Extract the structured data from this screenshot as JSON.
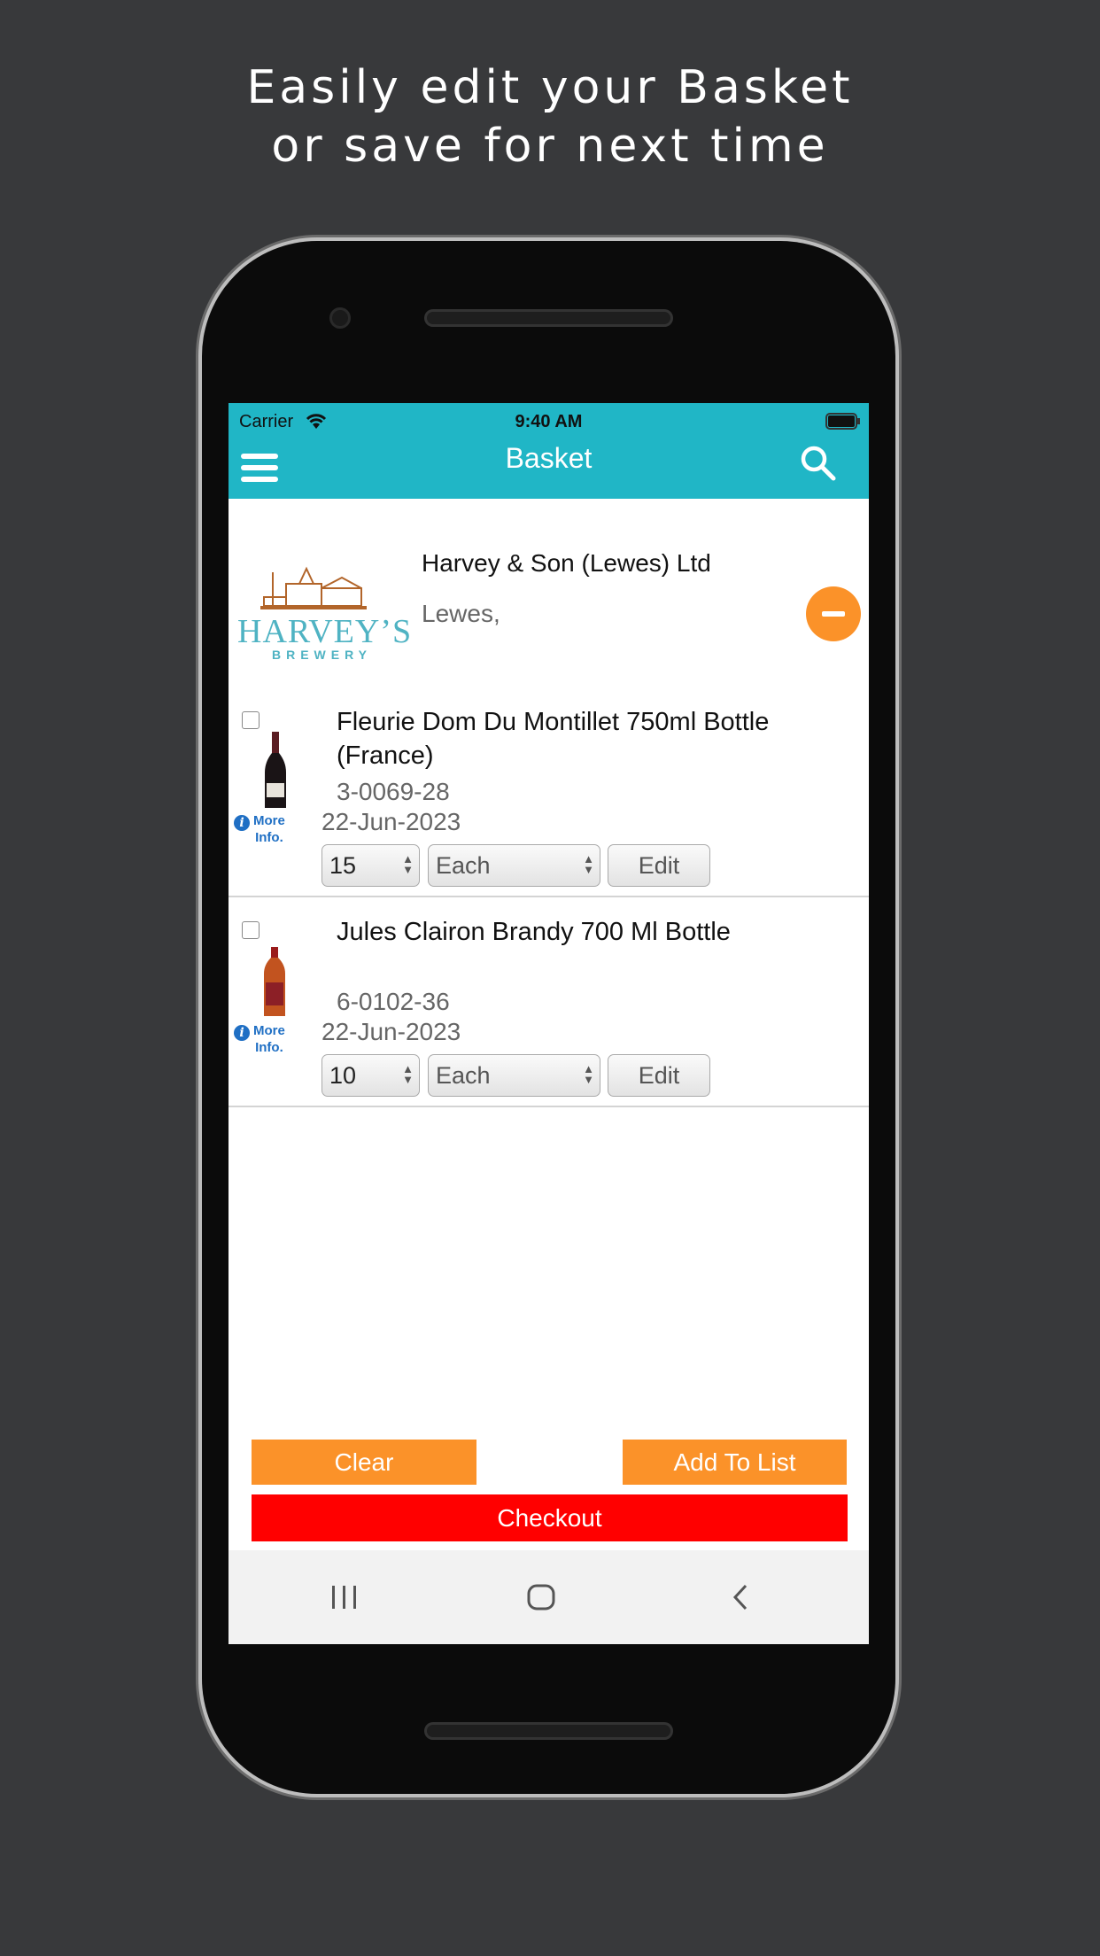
{
  "headline": {
    "line1": "Easily edit your Basket",
    "line2": "or save for next time"
  },
  "status_bar": {
    "carrier": "Carrier",
    "time": "9:40 AM"
  },
  "header": {
    "title": "Basket",
    "menu_icon": "hamburger-icon",
    "search_icon": "search-icon"
  },
  "supplier": {
    "logo_text": "HARVEY'S",
    "logo_subtext": "BREWERY",
    "name": "Harvey & Son (Lewes) Ltd",
    "location": "Lewes,",
    "remove_icon": "minus-circle-icon"
  },
  "items": [
    {
      "name_line1": "Fleurie Dom Du Montillet 750ml Bottle",
      "name_line2": "(France)",
      "code": "3-0069-28",
      "date": "22-Jun-2023",
      "quantity": "15",
      "unit": "Each",
      "edit_label": "Edit",
      "more_line1": "More",
      "more_line2": "Info.",
      "checked": false
    },
    {
      "name_line1": "Jules Clairon Brandy 700 Ml Bottle",
      "name_line2": "",
      "code": "6-0102-36",
      "date": "22-Jun-2023",
      "quantity": "10",
      "unit": "Each",
      "edit_label": "Edit",
      "more_line1": "More",
      "more_line2": "Info.",
      "checked": false
    }
  ],
  "actions": {
    "clear": "Clear",
    "add_to_list": "Add To List",
    "checkout": "Checkout"
  },
  "colors": {
    "header": "#20b6c6",
    "orange": "#fb9229",
    "checkout": "#ff0000",
    "link": "#1f6fc4"
  }
}
